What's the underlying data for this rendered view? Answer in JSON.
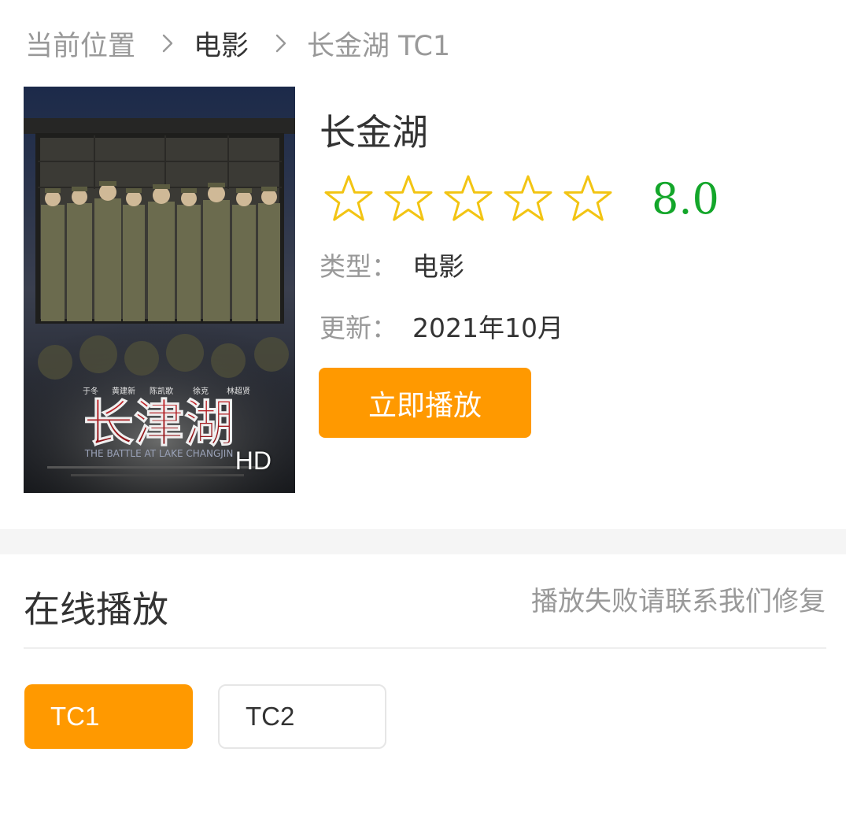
{
  "breadcrumb": {
    "home": "当前位置",
    "category": "电影",
    "current": "长金湖 TC1"
  },
  "movie": {
    "title": "长金湖",
    "rating": 8.0,
    "rating_text": "8.0",
    "stars_total": 5,
    "type_label": "类型：",
    "type_value": "电影",
    "update_label": "更新：",
    "update_value": "2021年10月",
    "play_button": "立即播放"
  },
  "poster": {
    "quality": "HD",
    "title_art": "长津湖",
    "subtitle_art": "THE BATTLE AT LAKE CHANGJIN",
    "cast": [
      "于冬",
      "黄建新",
      "陈凯歌",
      "徐克",
      "林超贤"
    ]
  },
  "online": {
    "title": "在线播放",
    "report_link": "播放失败请联系我们修复",
    "episodes": [
      {
        "label": "TC1",
        "active": true
      },
      {
        "label": "TC2",
        "active": false
      }
    ]
  },
  "colors": {
    "accent": "#ff9900",
    "score": "#13a62a",
    "star_outline": "#f2c413",
    "muted_text": "#999999"
  },
  "icons": {
    "breadcrumb_separator": "chevron-right-icon",
    "rating": "star-outline-icon"
  }
}
